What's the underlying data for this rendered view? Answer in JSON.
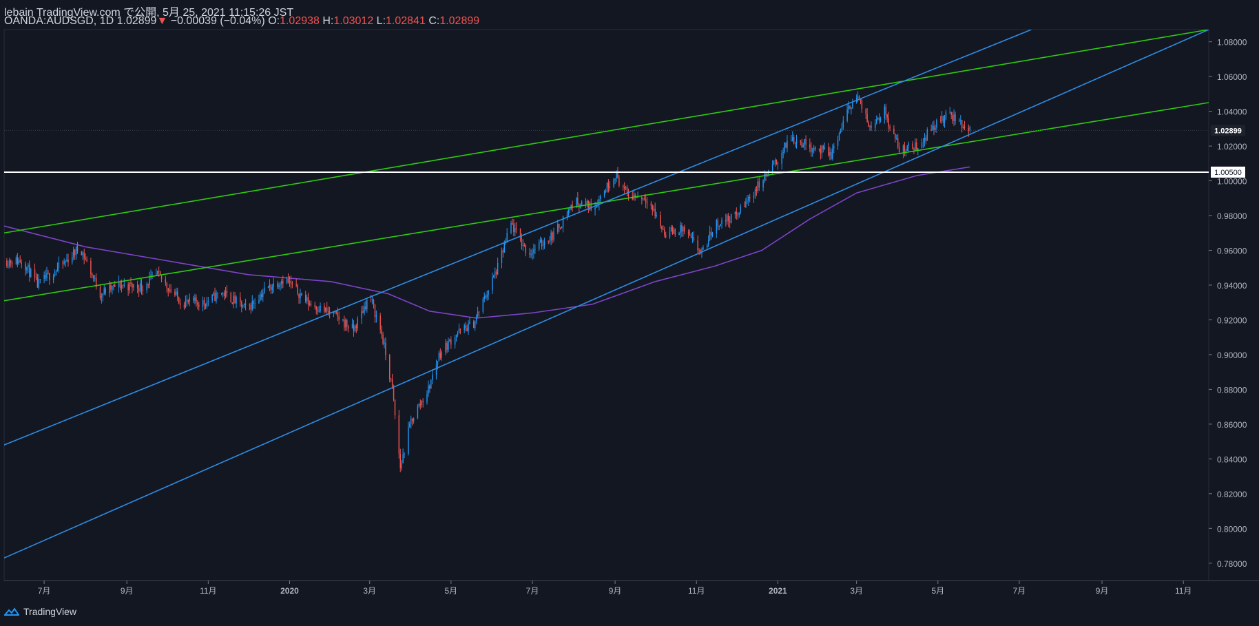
{
  "header": {
    "line1": "lebain TradingView.com で公開, 5月 25, 2021 11:15:26 JST",
    "symbol": "OANDA:AUDSGD, 1D",
    "last": "1.02899",
    "change": "−0.00039 (−0.04%)",
    "o_label": "O:",
    "o": "1.02938",
    "h_label": "H:",
    "h": "1.03012",
    "l_label": "L:",
    "l": "1.02841",
    "c_label": "C:",
    "c": "1.02899"
  },
  "footer": {
    "brand": "TradingView"
  },
  "colors": {
    "background": "#131722",
    "up": "#2196f3",
    "down": "#ef5350",
    "channel": "#2f8de4",
    "green": "#2ecc0e",
    "ma": "#7e44c8",
    "support": "#ffffff"
  },
  "chart_data": {
    "type": "candlestick",
    "symbol": "OANDA:AUDSGD",
    "interval": "1D",
    "ylim": [
      0.77,
      1.087
    ],
    "y_ticks": [
      "1.08000",
      "1.06000",
      "1.04000",
      "1.02000",
      "1.00000",
      "0.98000",
      "0.96000",
      "0.94000",
      "0.92000",
      "0.90000",
      "0.88000",
      "0.86000",
      "0.84000",
      "0.82000",
      "0.80000",
      "0.78000"
    ],
    "x_ticks": [
      "7月",
      "9月",
      "11月",
      "2020",
      "3月",
      "5月",
      "7月",
      "9月",
      "11月",
      "2021",
      "3月",
      "5月",
      "7月",
      "9月",
      "11月"
    ],
    "x_tick_dates": [
      "2019-07",
      "2019-09",
      "2019-11",
      "2020-01",
      "2020-03",
      "2020-05",
      "2020-07",
      "2020-09",
      "2020-11",
      "2021-01",
      "2021-03",
      "2021-05",
      "2021-07",
      "2021-09",
      "2021-11"
    ],
    "last_price_label": "1.02899",
    "support_label": "1.00500",
    "support_level": 1.005,
    "price_path": [
      [
        "2019-06-01",
        0.954
      ],
      [
        "2019-06-15",
        0.954
      ],
      [
        "2019-06-26",
        0.94
      ],
      [
        "2019-07-15",
        0.952
      ],
      [
        "2019-07-28",
        0.962
      ],
      [
        "2019-08-12",
        0.935
      ],
      [
        "2019-08-26",
        0.94
      ],
      [
        "2019-09-12",
        0.939
      ],
      [
        "2019-09-24",
        0.946
      ],
      [
        "2019-10-12",
        0.93
      ],
      [
        "2019-10-30",
        0.93
      ],
      [
        "2019-11-11",
        0.936
      ],
      [
        "2019-11-30",
        0.926
      ],
      [
        "2019-12-13",
        0.937
      ],
      [
        "2019-12-28",
        0.944
      ],
      [
        "2020-01-15",
        0.93
      ],
      [
        "2020-02-05",
        0.922
      ],
      [
        "2020-02-18",
        0.914
      ],
      [
        "2020-03-01",
        0.934
      ],
      [
        "2020-03-10",
        0.912
      ],
      [
        "2020-03-18",
        0.88
      ],
      [
        "2020-03-24",
        0.835
      ],
      [
        "2020-04-01",
        0.862
      ],
      [
        "2020-04-14",
        0.88
      ],
      [
        "2020-04-22",
        0.9
      ],
      [
        "2020-05-05",
        0.912
      ],
      [
        "2020-05-18",
        0.918
      ],
      [
        "2020-06-05",
        0.95
      ],
      [
        "2020-06-15",
        0.975
      ],
      [
        "2020-06-28",
        0.958
      ],
      [
        "2020-07-18",
        0.97
      ],
      [
        "2020-08-01",
        0.988
      ],
      [
        "2020-08-16",
        0.985
      ],
      [
        "2020-09-01",
        1.004
      ],
      [
        "2020-09-10",
        0.992
      ],
      [
        "2020-09-25",
        0.99
      ],
      [
        "2020-10-08",
        0.97
      ],
      [
        "2020-10-22",
        0.972
      ],
      [
        "2020-11-05",
        0.958
      ],
      [
        "2020-11-15",
        0.975
      ],
      [
        "2020-12-01",
        0.98
      ],
      [
        "2020-12-15",
        0.995
      ],
      [
        "2021-01-02",
        1.013
      ],
      [
        "2021-01-10",
        1.025
      ],
      [
        "2021-01-25",
        1.02
      ],
      [
        "2021-02-10",
        1.015
      ],
      [
        "2021-02-25",
        1.045
      ],
      [
        "2021-03-02",
        1.048
      ],
      [
        "2021-03-10",
        1.032
      ],
      [
        "2021-03-22",
        1.04
      ],
      [
        "2021-04-02",
        1.018
      ],
      [
        "2021-04-16",
        1.02
      ],
      [
        "2021-04-28",
        1.032
      ],
      [
        "2021-05-10",
        1.038
      ],
      [
        "2021-05-25",
        1.029
      ]
    ],
    "moving_average": [
      [
        "2019-06-01",
        0.974
      ],
      [
        "2019-08-01",
        0.962
      ],
      [
        "2019-10-01",
        0.954
      ],
      [
        "2019-12-01",
        0.946
      ],
      [
        "2020-02-01",
        0.942
      ],
      [
        "2020-03-15",
        0.935
      ],
      [
        "2020-04-15",
        0.925
      ],
      [
        "2020-05-20",
        0.921
      ],
      [
        "2020-07-01",
        0.924
      ],
      [
        "2020-08-15",
        0.929
      ],
      [
        "2020-10-01",
        0.942
      ],
      [
        "2020-11-15",
        0.951
      ],
      [
        "2020-12-20",
        0.96
      ],
      [
        "2021-01-25",
        0.978
      ],
      [
        "2021-03-01",
        0.993
      ],
      [
        "2021-04-15",
        1.003
      ],
      [
        "2021-05-25",
        1.008
      ]
    ],
    "trendlines": [
      {
        "color": "#2ecc0e",
        "from": [
          "2019-06-01",
          0.97
        ],
        "to": [
          "2021-11-20",
          1.087
        ]
      },
      {
        "color": "#2ecc0e",
        "from": [
          "2019-06-01",
          0.931
        ],
        "to": [
          "2021-11-20",
          1.045
        ]
      },
      {
        "color": "#2f8de4",
        "from": [
          "2019-06-01",
          0.848
        ],
        "to": [
          "2021-07-10",
          1.087
        ]
      },
      {
        "color": "#2f8de4",
        "from": [
          "2019-06-01",
          0.783
        ],
        "to": [
          "2021-11-20",
          1.087
        ]
      }
    ]
  }
}
